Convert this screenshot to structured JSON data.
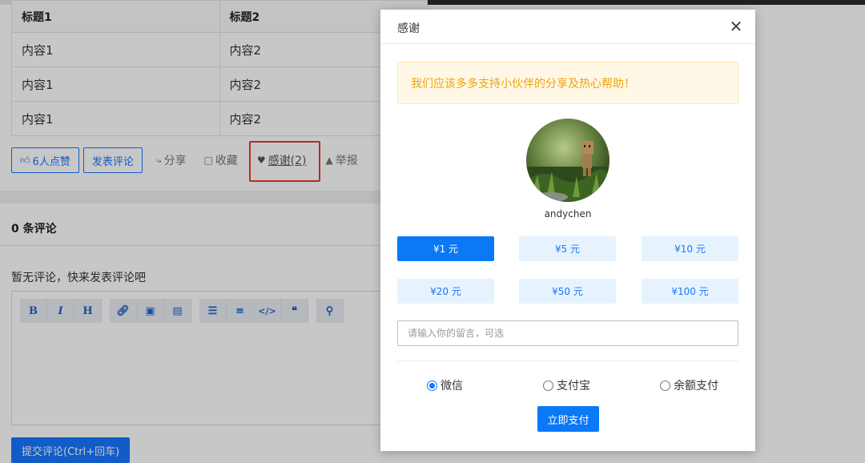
{
  "table": {
    "headers": [
      "标题1",
      "标题2"
    ],
    "rows": [
      [
        "内容1",
        "内容2"
      ],
      [
        "内容1",
        "内容2"
      ],
      [
        "内容1",
        "内容2"
      ]
    ]
  },
  "actions": {
    "like": "6人点赞",
    "comment": "发表评论",
    "share": "分享",
    "favorite": "收藏",
    "thanks": "感谢(2)",
    "report": "举报"
  },
  "comments": {
    "count_label": "0 条评论",
    "empty_text": "暂无评论，快来发表评论吧",
    "submit_label": "提交评论(Ctrl+回车)"
  },
  "editor_toolbar": {
    "bold": "B",
    "italic": "I",
    "heading": "H"
  },
  "modal": {
    "title": "感谢",
    "close_glyph": "✕",
    "notice": "我们应该多多支持小伙伴的分享及热心帮助！",
    "username": "andychen",
    "amounts": [
      "¥1 元",
      "¥5 元",
      "¥10 元",
      "¥20 元",
      "¥50 元",
      "¥100 元"
    ],
    "selected_amount": "¥1 元",
    "message_placeholder": "请输入你的留言，可选",
    "payment_methods": [
      "微信",
      "支付宝",
      "余额支付"
    ],
    "selected_payment": "微信",
    "pay_button": "立即支付"
  },
  "colors": {
    "primary": "#1677ff",
    "highlight": "#e53935",
    "notice_text": "#f2a20c"
  }
}
